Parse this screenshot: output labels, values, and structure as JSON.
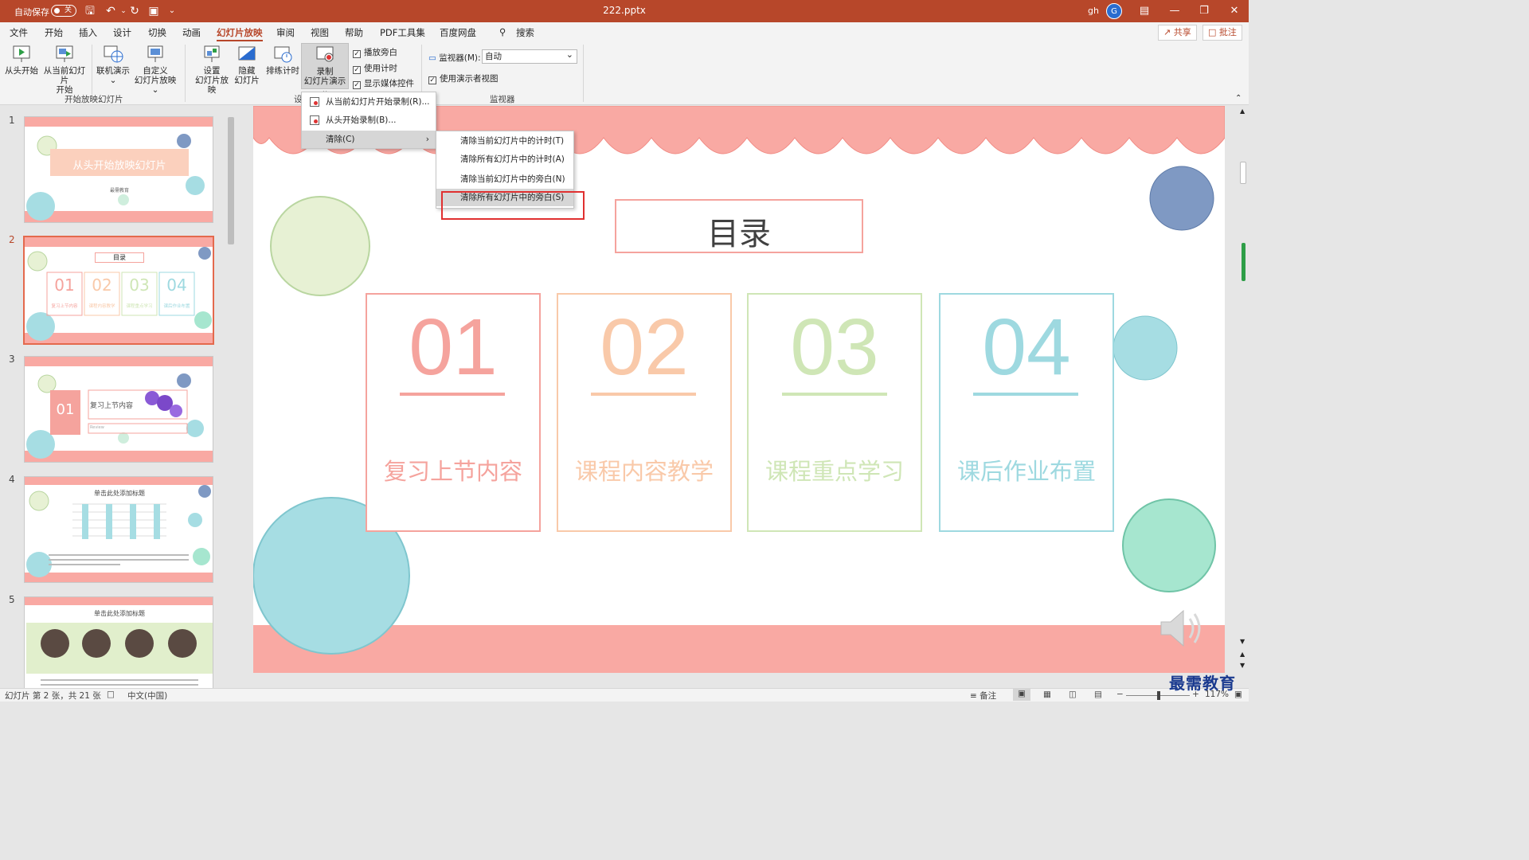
{
  "titlebar": {
    "autosave_label": "自动保存",
    "autosave_state": "关",
    "filename": "222.pptx",
    "user": "gh",
    "avatar_letter": "G"
  },
  "menu": {
    "items": [
      "文件",
      "开始",
      "插入",
      "设计",
      "切换",
      "动画",
      "幻灯片放映",
      "审阅",
      "视图",
      "帮助",
      "PDF工具集",
      "百度网盘",
      "搜索"
    ],
    "active_index": 6,
    "share": "共享",
    "comments": "批注"
  },
  "ribbon": {
    "from_start": "从头开始",
    "from_current_1": "从当前幻灯片",
    "from_current_2": "开始",
    "online_1": "联机演示",
    "custom_1": "自定义",
    "custom_2": "幻灯片放映",
    "group_start": "开始放映幻灯片",
    "setup_1": "设置",
    "setup_2": "幻灯片放映",
    "hide_1": "隐藏",
    "hide_2": "幻灯片",
    "rehearse": "排练计时",
    "record_1": "录制",
    "record_2": "幻灯片演示",
    "chk_narration": "播放旁白",
    "chk_timing": "使用计时",
    "chk_media": "显示媒体控件",
    "group_setup": "设",
    "monitor_label": "监视器(M):",
    "monitor_value": "自动",
    "chk_presenter": "使用演示者视图",
    "group_monitor": "监视器"
  },
  "record_menu": {
    "from_current": "从当前幻灯片开始录制(R)...",
    "from_start": "从头开始录制(B)...",
    "clear": "清除(C)"
  },
  "clear_menu": {
    "items": [
      "清除当前幻灯片中的计时(T)",
      "清除所有幻灯片中的计时(A)",
      "清除当前幻灯片中的旁白(N)",
      "清除所有幻灯片中的旁白(S)"
    ],
    "highlighted_index": 3
  },
  "thumbnails": {
    "numbers": [
      "1",
      "2",
      "3",
      "4",
      "5"
    ],
    "selected_index": 1,
    "t1_title": "从头开始放映幻灯片",
    "t1_sub": "最需教育",
    "t2_title": "目录",
    "t2_nums": [
      "01",
      "02",
      "03",
      "04"
    ],
    "t2_labels": [
      "复习上节内容",
      "课程内容教学",
      "课程重点学习",
      "课后作业布置"
    ],
    "t3_num": "01",
    "t3_title": "复习上节内容",
    "t3_sub": "Review",
    "t4_title": "单击此处添加标题",
    "t5_title": "单击此处添加标题"
  },
  "slide": {
    "title": "目录",
    "items": [
      {
        "num": "01",
        "label": "复习上节内容",
        "color": "#f5a39d"
      },
      {
        "num": "02",
        "label": "课程内容教学",
        "color": "#f9c9a9"
      },
      {
        "num": "03",
        "label": "课程重点学习",
        "color": "#cfe6b6"
      },
      {
        "num": "04",
        "label": "课后作业布置",
        "color": "#9ed9e0"
      }
    ]
  },
  "statusbar": {
    "slide_info": "幻灯片 第 2 张，共 21 张",
    "language": "中文(中国)",
    "notes": "备注",
    "zoom": "117%"
  },
  "watermark": "最需教育",
  "colors": {
    "accent": "#b7472a",
    "scallop": "#f9a9a3",
    "highlight_box": "#e03030"
  }
}
